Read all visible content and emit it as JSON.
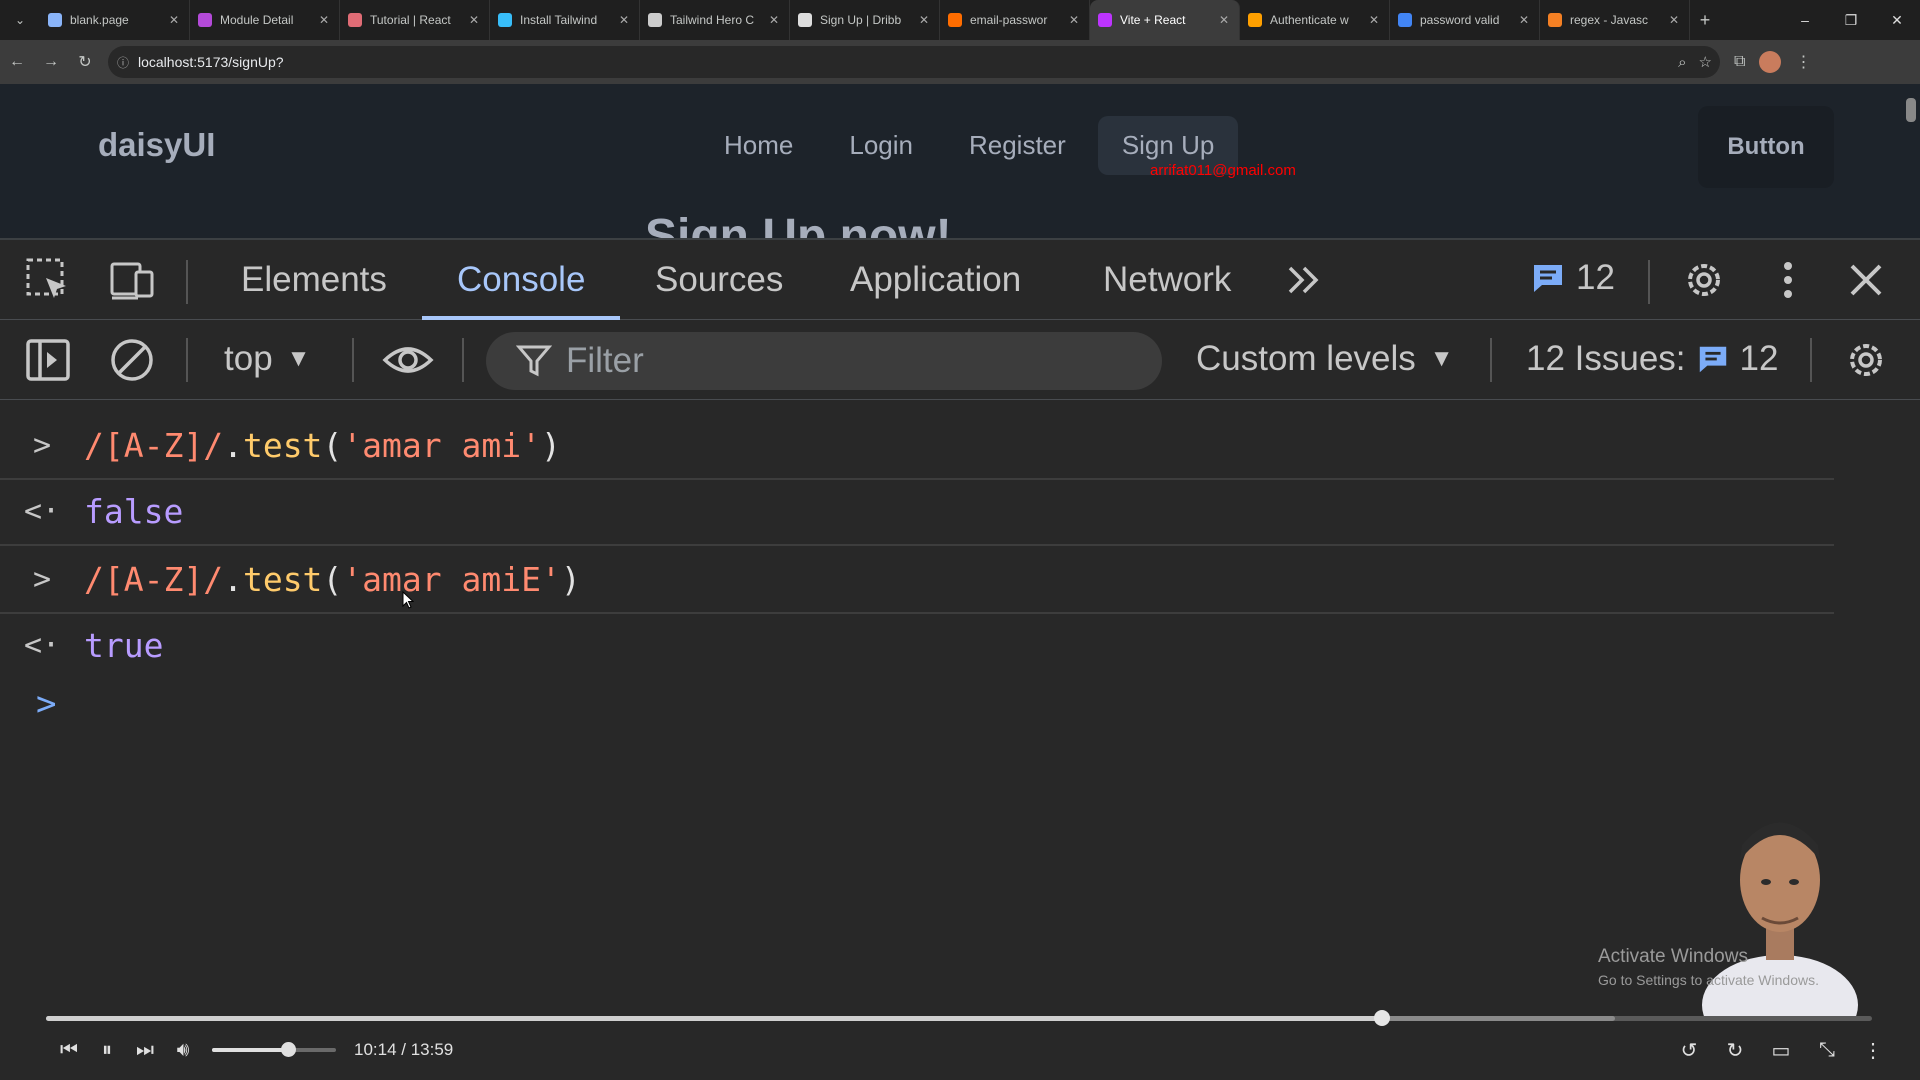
{
  "browser": {
    "tabs": [
      {
        "title": "blank.page",
        "favicon_color": "#8ab4f8"
      },
      {
        "title": "Module Detail",
        "favicon_color": "#b44ad9"
      },
      {
        "title": "Tutorial | React",
        "favicon_color": "#e06c75"
      },
      {
        "title": "Install Tailwind",
        "favicon_color": "#38bdf8"
      },
      {
        "title": "Tailwind Hero C",
        "favicon_color": "#cccccc"
      },
      {
        "title": "Sign Up | Dribb",
        "favicon_color": "#dddddd"
      },
      {
        "title": "email-passwor",
        "favicon_color": "#ff6d00"
      },
      {
        "title": "Vite + React",
        "favicon_color": "#bd34fe",
        "active": true
      },
      {
        "title": "Authenticate w",
        "favicon_color": "#ffa000"
      },
      {
        "title": "password valid",
        "favicon_color": "#4285f4"
      },
      {
        "title": "regex - Javasc",
        "favicon_color": "#f48024"
      }
    ],
    "url": "localhost:5173/signUp?"
  },
  "page": {
    "brand": "daisyUI",
    "nav": [
      "Home",
      "Login",
      "Register",
      "Sign Up"
    ],
    "active_nav": "Sign Up",
    "button_label": "Button",
    "email_text": "arrifat011@gmail.com",
    "heading_partial": "Sign Up now!"
  },
  "devtools": {
    "tabs": [
      "Elements",
      "Console",
      "Sources",
      "Application",
      "Network"
    ],
    "active_tab": "Console",
    "issues_badge": "12",
    "context": "top",
    "filter_placeholder": "Filter",
    "levels": "Custom levels",
    "issues_label": "12 Issues:",
    "issues_count": "12",
    "accent": "#a8c7fa"
  },
  "console": {
    "entries": [
      {
        "kind": "input",
        "regex": "/[A-Z]/",
        "dot": ".",
        "fn": "test",
        "open": "(",
        "arg": "'amar ami'",
        "close": ")"
      },
      {
        "kind": "output",
        "value": "false"
      },
      {
        "kind": "input",
        "regex": "/[A-Z]/",
        "dot": ".",
        "fn": "test",
        "open": "(",
        "arg": "'amar amiE'",
        "close": ")"
      },
      {
        "kind": "output",
        "value": "true"
      }
    ]
  },
  "overlay": {
    "watermark_title": "Activate Windows",
    "watermark_sub": "Go to Settings to activate Windows."
  },
  "player": {
    "time": "10:14 / 13:59",
    "progress_fraction": 0.7316,
    "buffered_fraction": 0.859,
    "volume_fraction": 0.61
  }
}
